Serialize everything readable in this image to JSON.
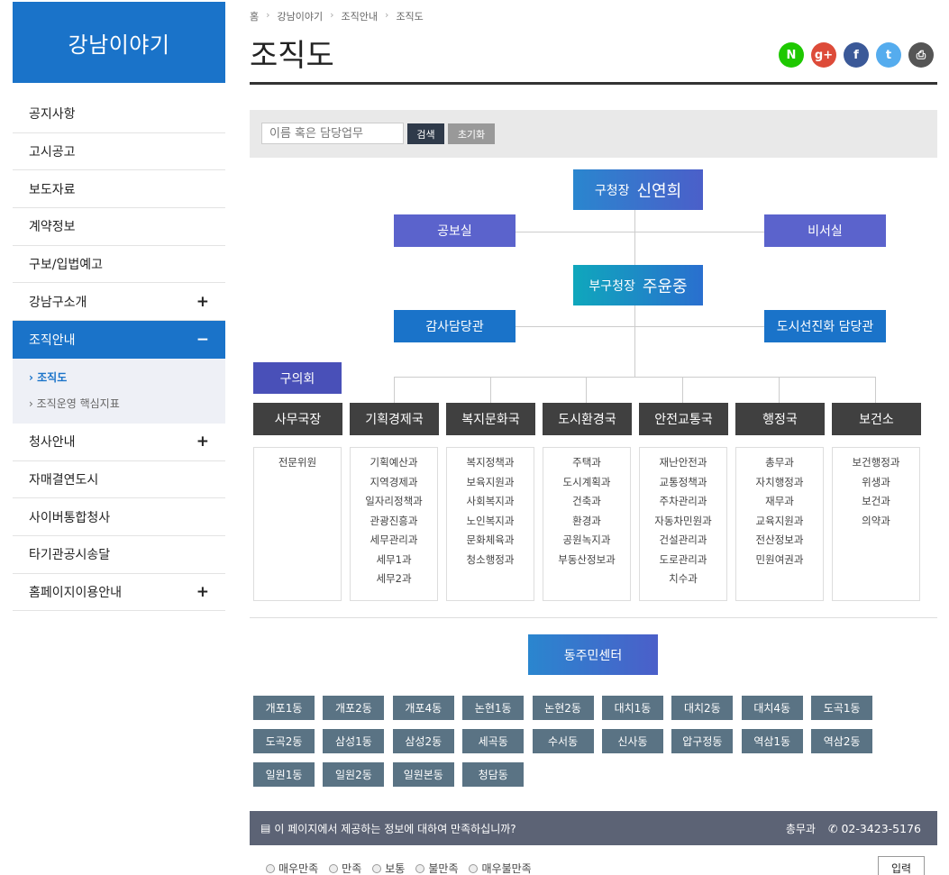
{
  "site_title": "강남이야기",
  "menu": [
    {
      "label": "공지사항",
      "sign": ""
    },
    {
      "label": "고시공고",
      "sign": ""
    },
    {
      "label": "보도자료",
      "sign": ""
    },
    {
      "label": "계약정보",
      "sign": ""
    },
    {
      "label": "구보/입법예고",
      "sign": ""
    },
    {
      "label": "강남구소개",
      "sign": "+"
    },
    {
      "label": "조직안내",
      "sign": "−"
    }
  ],
  "submenu": [
    "› 조직도",
    "› 조직운영 핵심지표"
  ],
  "menu_after": [
    {
      "label": "청사안내",
      "sign": "+"
    },
    {
      "label": "자매결연도시",
      "sign": ""
    },
    {
      "label": "사이버통합청사",
      "sign": ""
    },
    {
      "label": "타기관공시송달",
      "sign": ""
    },
    {
      "label": "홈페이지이용안내",
      "sign": "+"
    }
  ],
  "breadcrumb": [
    "홈",
    "강남이야기",
    "조직안내",
    "조직도"
  ],
  "page_title": "조직도",
  "share": [
    {
      "label": "N",
      "color": "#1ec800",
      "icon": "naver-icon"
    },
    {
      "label": "g+",
      "color": "#dd4b39",
      "icon": "google-plus-icon"
    },
    {
      "label": "f",
      "color": "#3b5998",
      "icon": "facebook-icon"
    },
    {
      "label": "t",
      "color": "#55acee",
      "icon": "twitter-icon"
    },
    {
      "label": "⎙",
      "color": "#555555",
      "icon": "print-icon"
    }
  ],
  "search": {
    "placeholder": "이름 혹은 담당업무",
    "button": "검색",
    "reset": "초기화"
  },
  "org": {
    "mayor_title": "구청장",
    "mayor_name": "신연희",
    "pr": "공보실",
    "secretary": "비서실",
    "deputy_title": "부구청장",
    "deputy_name": "주윤중",
    "audit": "감사담당관",
    "urban": "도시선진화 담당관",
    "council": "구의회"
  },
  "departments": [
    {
      "name": "사무국장",
      "teams": [
        "전문위원"
      ]
    },
    {
      "name": "기획경제국",
      "teams": [
        "기획예산과",
        "지역경제과",
        "일자리정책과",
        "관광진흥과",
        "세무관리과",
        "세무1과",
        "세무2과"
      ]
    },
    {
      "name": "복지문화국",
      "teams": [
        "복지정책과",
        "보육지원과",
        "사회복지과",
        "노인복지과",
        "문화체육과",
        "청소행정과"
      ]
    },
    {
      "name": "도시환경국",
      "teams": [
        "주택과",
        "도시계획과",
        "건축과",
        "환경과",
        "공원녹지과",
        "부동산정보과"
      ]
    },
    {
      "name": "안전교통국",
      "teams": [
        "재난안전과",
        "교통정책과",
        "주차관리과",
        "자동차민원과",
        "건설관리과",
        "도로관리과",
        "치수과"
      ]
    },
    {
      "name": "행정국",
      "teams": [
        "총무과",
        "자치행정과",
        "재무과",
        "교육지원과",
        "전산정보과",
        "민원여권과"
      ]
    },
    {
      "name": "보건소",
      "teams": [
        "보건행정과",
        "위생과",
        "보건과",
        "의약과"
      ]
    }
  ],
  "community_center": "동주민센터",
  "dongs": [
    "개포1동",
    "개포2동",
    "개포4동",
    "논현1동",
    "논현2동",
    "대치1동",
    "대치2동",
    "대치4동",
    "도곡1동",
    "도곡2동",
    "삼성1동",
    "삼성2동",
    "세곡동",
    "수서동",
    "신사동",
    "압구정동",
    "역삼1동",
    "역삼2동",
    "일원1동",
    "일원2동",
    "일원본동",
    "청담동"
  ],
  "survey": {
    "question": "이 페이지에서 제공하는 정보에 대하여 만족하십니까?",
    "dept": "총무과",
    "phone": "02-3423-5176",
    "options": [
      "매우만족",
      "만족",
      "보통",
      "불만족",
      "매우불만족"
    ],
    "submit": "입력"
  }
}
